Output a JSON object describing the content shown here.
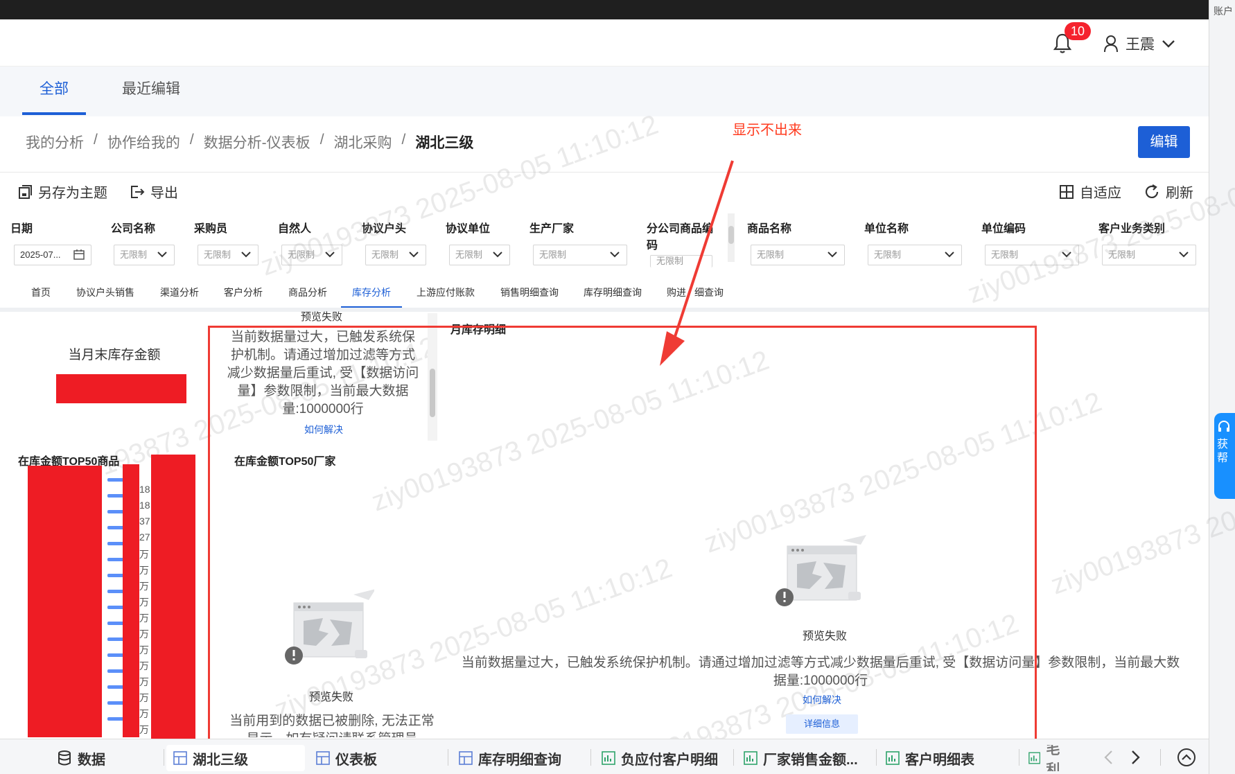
{
  "right_strip": {
    "account_label": "账户"
  },
  "header": {
    "notification_count": "10",
    "user_name": "王震"
  },
  "main_tabs": [
    {
      "label": "全部"
    },
    {
      "label": "最近编辑"
    }
  ],
  "breadcrumb": {
    "items": [
      "我的分析",
      "协作给我的",
      "数据分析-仪表板",
      "湖北采购"
    ],
    "current": "湖北三级",
    "separator": "/"
  },
  "annotation": {
    "text": "显示不出来"
  },
  "edit_button": "编辑",
  "toolbar": {
    "save_as_theme": "另存为主题",
    "export": "导出",
    "adaptive": "自适应",
    "refresh": "刷新"
  },
  "filters": {
    "date": {
      "label": "日期",
      "value": "2025-07..."
    },
    "company": {
      "label": "公司名称",
      "value": "无限制"
    },
    "buyer": {
      "label": "采购员",
      "value": "无限制"
    },
    "person": {
      "label": "自然人",
      "value": "无限制"
    },
    "agreement_head": {
      "label": "协议户头",
      "value": "无限制"
    },
    "agreement_unit": {
      "label": "协议单位",
      "value": "无限制"
    },
    "manufacturer": {
      "label": "生产厂家",
      "value": "无限制"
    },
    "branch_code": {
      "label_1": "分公司商品编",
      "label_2": "码",
      "value": "无限制"
    },
    "product_name": {
      "label": "商品名称",
      "value": "无限制"
    },
    "unit_name": {
      "label": "单位名称",
      "value": "无限制"
    },
    "unit_code": {
      "label": "单位编码",
      "value": "无限制"
    },
    "business_type": {
      "label": "客户业务类别",
      "value": "无限制"
    }
  },
  "sub_tabs": [
    "首页",
    "协议户头销售",
    "渠道分析",
    "客户分析",
    "商品分析",
    "库存分析",
    "上游应付账款",
    "销售明细查询",
    "库存明细查询",
    "购进",
    "细查询"
  ],
  "panels": {
    "month_end_stock": {
      "title": "当月末库存金额"
    },
    "top_preview": {
      "status": "预览失败",
      "message_lines": [
        "当前数据量过大，已触发系统保",
        "护机制。请通过增加过滤等方式",
        "减少数据量后重试, 受【数据访问",
        "量】参数限制，当前最大数据",
        "量:1000000行"
      ],
      "link": "如何解决"
    },
    "monthly_stock_detail": {
      "title": "月库存明细",
      "status": "预览失败",
      "message_line_1": "当前数据量过大，已触发系统保护机制。请通过增加过滤等方式减少数据量后重试, 受【数据访问量】参数限制，当前最大数",
      "message_line_2": "据量:1000000行",
      "link": "如何解决",
      "detail_button": "详细信息"
    },
    "top50_products": {
      "title": "在库金额TOP50商品",
      "tick_labels": [
        "18",
        "18",
        "37",
        "27",
        "万",
        "万",
        "万",
        "万",
        "万",
        "万",
        "万",
        "万",
        "万",
        "万",
        "万",
        "万"
      ]
    },
    "top50_factories": {
      "title": "在库金额TOP50厂家",
      "status": "预览失败",
      "message_line_1": "当前用到的数据已被删除, 无法正常",
      "message_line_2": "显示，如有疑问请联系管理员"
    }
  },
  "watermark": {
    "text": "ziy00193873 2025-08-05 11:10:12"
  },
  "bottom_tabs": [
    {
      "label": "数据",
      "icon": "database-icon"
    },
    {
      "label": "湖北三级",
      "icon": "dashboard-icon"
    },
    {
      "label": "仪表板",
      "icon": "dashboard-icon"
    },
    {
      "label": "库存明细查询",
      "icon": "dashboard-icon"
    },
    {
      "label": "负应付客户明细",
      "icon": "chart-icon"
    },
    {
      "label": "厂家销售金额...",
      "icon": "chart-icon"
    },
    {
      "label": "客户明细表",
      "icon": "chart-icon"
    },
    {
      "label": "毛利",
      "icon": "chart-icon"
    }
  ],
  "help": {
    "line_1": "获",
    "line_2": "帮"
  }
}
